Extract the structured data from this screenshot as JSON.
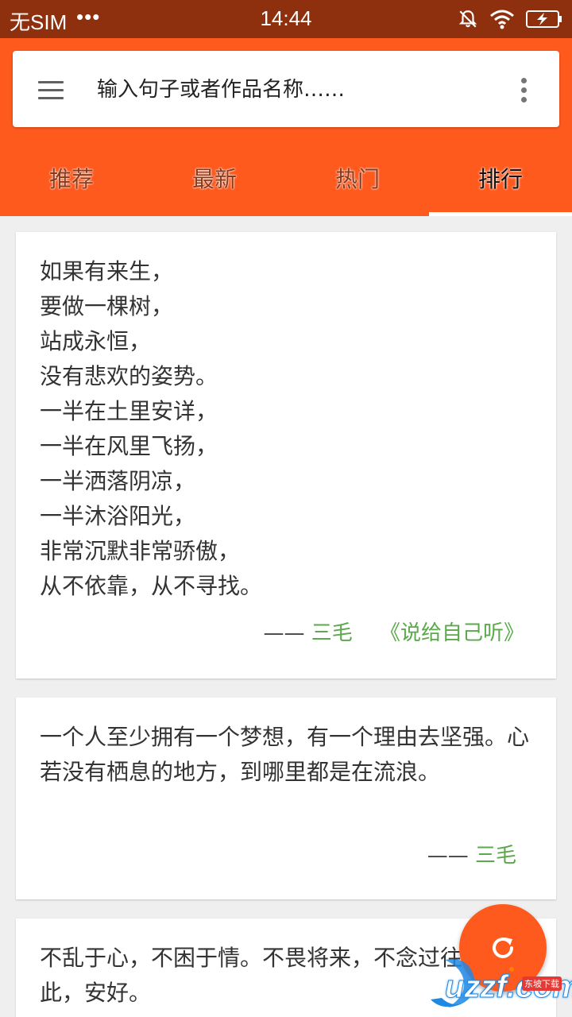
{
  "status_bar": {
    "carrier": "无SIM",
    "dots": "•••",
    "time": "14:44"
  },
  "search": {
    "placeholder": "输入句子或者作品名称……"
  },
  "tabs": [
    {
      "label": "推荐",
      "active": false
    },
    {
      "label": "最新",
      "active": false
    },
    {
      "label": "热门",
      "active": false
    },
    {
      "label": "排行",
      "active": true
    }
  ],
  "cards": [
    {
      "text": "如果有来生，\n要做一棵树，\n站成永恒，\n没有悲欢的姿势。\n一半在土里安详，\n一半在风里飞扬，\n一半洒落阴凉，\n一半沐浴阳光，\n非常沉默非常骄傲，\n从不依靠，从不寻找。",
      "dash": "——",
      "author": "三毛",
      "work": "《说给自己听》"
    },
    {
      "text": "一个人至少拥有一个梦想，有一个理由去坚强。心若没有栖息的地方，到哪里都是在流浪。",
      "dash": "——",
      "author": "三毛"
    },
    {
      "text": "不乱于心，不困于情。不畏将来，不念过往。如此，安好。"
    }
  ],
  "watermark": {
    "text": "uzzf.com",
    "badge": "东坡下载"
  },
  "colors": {
    "accent": "#ff5a1e",
    "status_bar": "#8e2f0d",
    "author_green": "#5aa94a"
  }
}
